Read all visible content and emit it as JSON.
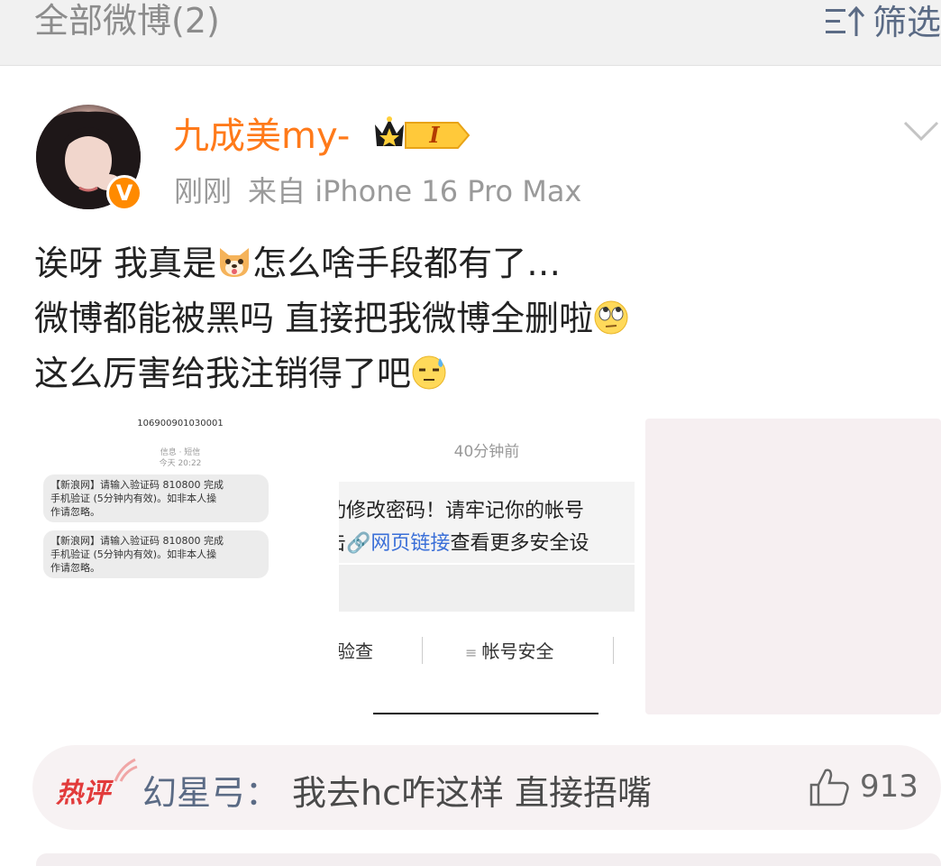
{
  "header": {
    "title": "全部微博(2)",
    "filter_label": "筛选",
    "filter_icon": "sort-filter-icon"
  },
  "post": {
    "username": "九成美my-",
    "level_badge": "I",
    "time": "刚刚",
    "source": "来自 iPhone 16 Pro Max",
    "lines": [
      {
        "before": "诶呀 我真是",
        "emoji": "dog-face-emoji",
        "after": "怎么啥手段都有了…"
      },
      {
        "before": "微博都能被黑吗 直接把我微博全删啦",
        "emoji": "eye-roll-emoji",
        "after": ""
      },
      {
        "before": "这么厉害给我注销得了吧",
        "emoji": "sweat-face-emoji",
        "after": ""
      }
    ]
  },
  "images": {
    "sms": {
      "number": "106900901030001",
      "sub1": "信息 · 短信",
      "sub2": "今天 20:22",
      "messages": [
        "【新浪网】请输入验证码 810800 完成\n手机验证 (5分钟内有效)。如非本人操\n作请忽略。",
        "【新浪网】请输入验证码 810800 完成\n手机验证 (5分钟内有效)。如非本人操\n作请忽略。"
      ]
    },
    "notice": {
      "time": "40分钟前",
      "line1": "功修改密码！请牢记你的帐号",
      "line2_prefix": "击",
      "line2_link": "网页链接",
      "line2_suffix": "查看更多安全设",
      "btn_check": "验查",
      "btn_security": "帐号安全"
    }
  },
  "hot_comment": {
    "tag": "热评",
    "user": "幻星弓：",
    "text": "我去hc咋这样 直接捂嘴",
    "likes": "913"
  },
  "colors": {
    "username": "#ff7a1a",
    "link": "#5b6b85",
    "hot_tag": "#e23b3b",
    "badge": "#ff8a00"
  }
}
